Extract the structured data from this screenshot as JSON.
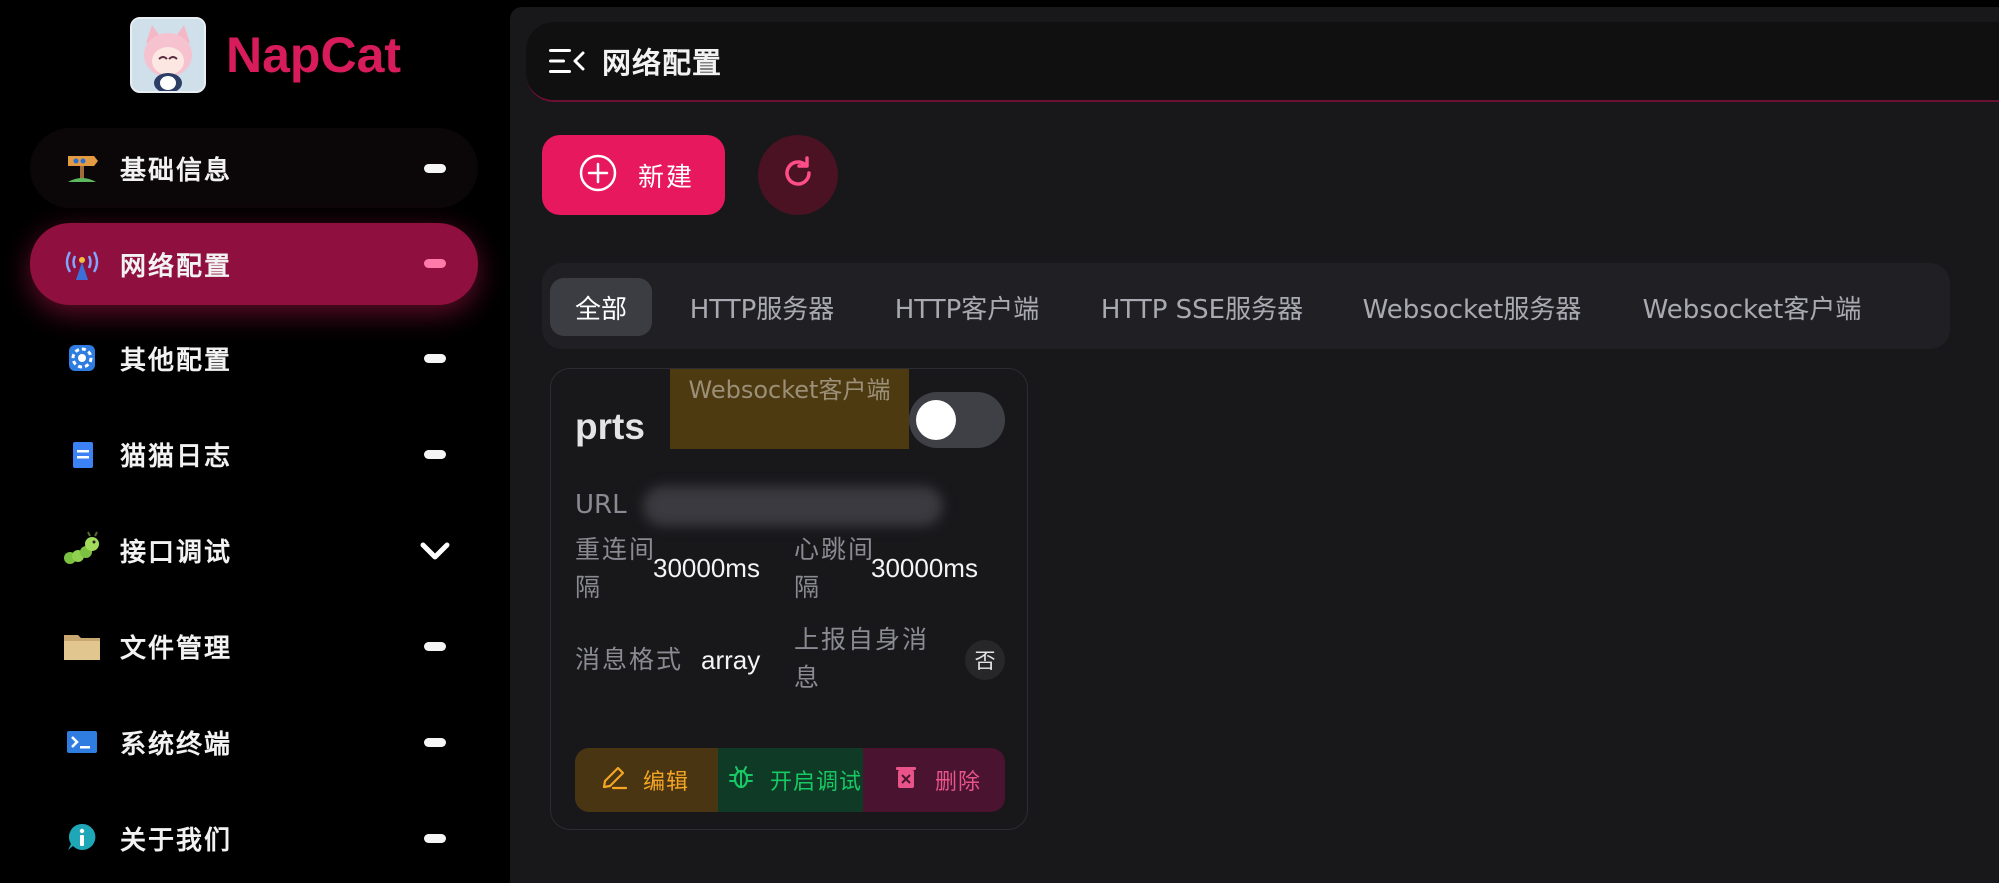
{
  "brand": {
    "name": "NapCat"
  },
  "sidebar": {
    "items": [
      {
        "label": "基础信息",
        "icon": "signpost-icon"
      },
      {
        "label": "网络配置",
        "icon": "antenna-icon",
        "active": true
      },
      {
        "label": "其他配置",
        "icon": "gear-icon"
      },
      {
        "label": "猫猫日志",
        "icon": "log-icon"
      },
      {
        "label": "接口调试",
        "icon": "caterpillar-icon",
        "expandable": true
      },
      {
        "label": "文件管理",
        "icon": "folder-icon"
      },
      {
        "label": "系统终端",
        "icon": "terminal-icon"
      },
      {
        "label": "关于我们",
        "icon": "info-icon"
      }
    ]
  },
  "header": {
    "title": "网络配置"
  },
  "toolbar": {
    "new_label": "新建"
  },
  "tabs": [
    {
      "label": "全部",
      "active": true
    },
    {
      "label": "HTTP服务器"
    },
    {
      "label": "HTTP客户端"
    },
    {
      "label": "HTTP SSE服务器"
    },
    {
      "label": "Websocket服务器"
    },
    {
      "label": "Websocket客户端"
    }
  ],
  "card": {
    "name": "prts",
    "type": "Websocket客户端",
    "enabled": false,
    "url_label": "URL",
    "url_value": "",
    "reconnect_label": "重连间隔",
    "reconnect_value": "30000ms",
    "heartbeat_label": "心跳间隔",
    "heartbeat_value": "30000ms",
    "format_label": "消息格式",
    "format_value": "array",
    "report_self_label": "上报自身消息",
    "report_self_value": "否",
    "actions": {
      "edit": "编辑",
      "debug": "开启调试",
      "delete": "删除"
    }
  },
  "colors": {
    "accent": "#e8185f",
    "active_nav": "#8f0f3e",
    "edit": "#f5a524",
    "debug": "#17c964",
    "delete": "#e8538a"
  }
}
